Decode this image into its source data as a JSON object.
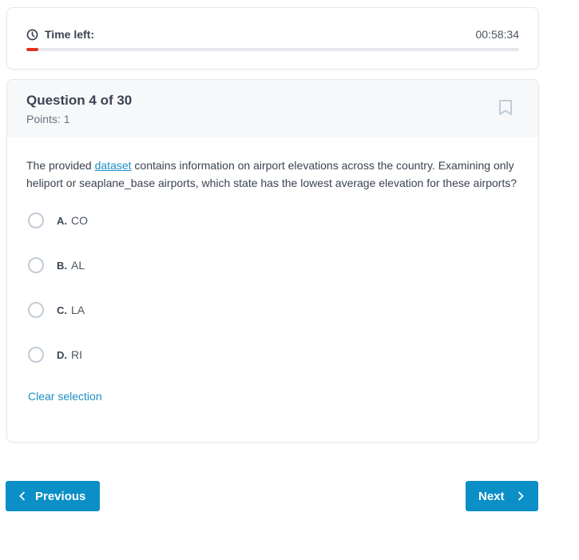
{
  "timer": {
    "label": "Time left:",
    "value": "00:58:34",
    "progress_fraction": 0.024,
    "progress_color": "#e5321e",
    "icon": "clock-icon"
  },
  "question": {
    "title": "Question 4 of 30",
    "points": "Points: 1",
    "bookmark_icon": "bookmark-icon",
    "text_before_link": "The provided ",
    "link_text": "dataset",
    "text_after_link": " contains information on airport elevations across the country. Examining only heliport or seaplane_base airports, which state has the lowest average elevation for these airports?",
    "options": [
      {
        "letter": "A.",
        "text": "CO"
      },
      {
        "letter": "B.",
        "text": "AL"
      },
      {
        "letter": "C.",
        "text": "LA"
      },
      {
        "letter": "D.",
        "text": "RI"
      }
    ],
    "clear_label": "Clear selection"
  },
  "nav": {
    "previous_label": "Previous",
    "next_label": "Next"
  },
  "colors": {
    "accent": "#0b8fc6",
    "link": "#1d8fc4",
    "timer_bar": "#e5321e"
  }
}
